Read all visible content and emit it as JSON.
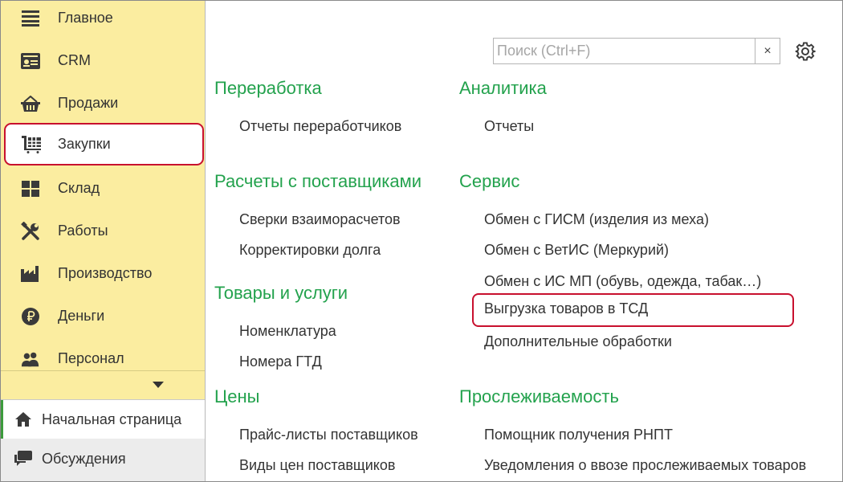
{
  "sidebar": {
    "items": [
      {
        "label": "Главное",
        "icon": "menu-icon"
      },
      {
        "label": "CRM",
        "icon": "crm-card-icon"
      },
      {
        "label": "Продажи",
        "icon": "basket-icon"
      },
      {
        "label": "Закупки",
        "icon": "cart-icon"
      },
      {
        "label": "Склад",
        "icon": "warehouse-icon"
      },
      {
        "label": "Работы",
        "icon": "tools-icon"
      },
      {
        "label": "Производство",
        "icon": "factory-icon"
      },
      {
        "label": "Деньги",
        "icon": "ruble-icon"
      },
      {
        "label": "Персонал",
        "icon": "people-icon"
      }
    ],
    "highlighted_item": "Закупки"
  },
  "bottom_nav": {
    "home": {
      "label": "Начальная страница",
      "icon": "home-icon"
    },
    "discussions": {
      "label": "Обсуждения",
      "icon": "chat-icon"
    }
  },
  "search": {
    "placeholder": "Поиск (Ctrl+F)",
    "value": "",
    "clear_label": "×"
  },
  "sections": {
    "pererabotka": {
      "title": "Переработка",
      "links": [
        "Отчеты переработчиков"
      ]
    },
    "raschety": {
      "title": "Расчеты с поставщиками",
      "links": [
        "Сверки взаиморасчетов",
        "Корректировки долга"
      ]
    },
    "tovary": {
      "title": "Товары и услуги",
      "links": [
        "Номенклатура",
        "Номера ГТД"
      ]
    },
    "ceny": {
      "title": "Цены",
      "links": [
        "Прайс-листы поставщиков",
        "Виды цен поставщиков"
      ]
    },
    "analitika": {
      "title": "Аналитика",
      "links": [
        "Отчеты"
      ]
    },
    "servis": {
      "title": "Сервис",
      "links": [
        "Обмен с ГИСМ (изделия из меха)",
        "Обмен с ВетИС (Меркурий)",
        "Обмен с ИС МП (обувь, одежда, табак…)",
        "Выгрузка товаров в ТСД",
        "Дополнительные обработки"
      ]
    },
    "proslezh": {
      "title": "Прослеживаемость",
      "links": [
        "Помощник получения РНПТ",
        "Уведомления о ввозе прослеживаемых товаров"
      ]
    }
  },
  "highlighted_link": "Выгрузка товаров в ТСД",
  "colors": {
    "sidebar_bg": "#fbeda0",
    "section_title": "#23a24d",
    "highlight_border": "#c8102e",
    "active_marker": "#3c9b3c"
  }
}
